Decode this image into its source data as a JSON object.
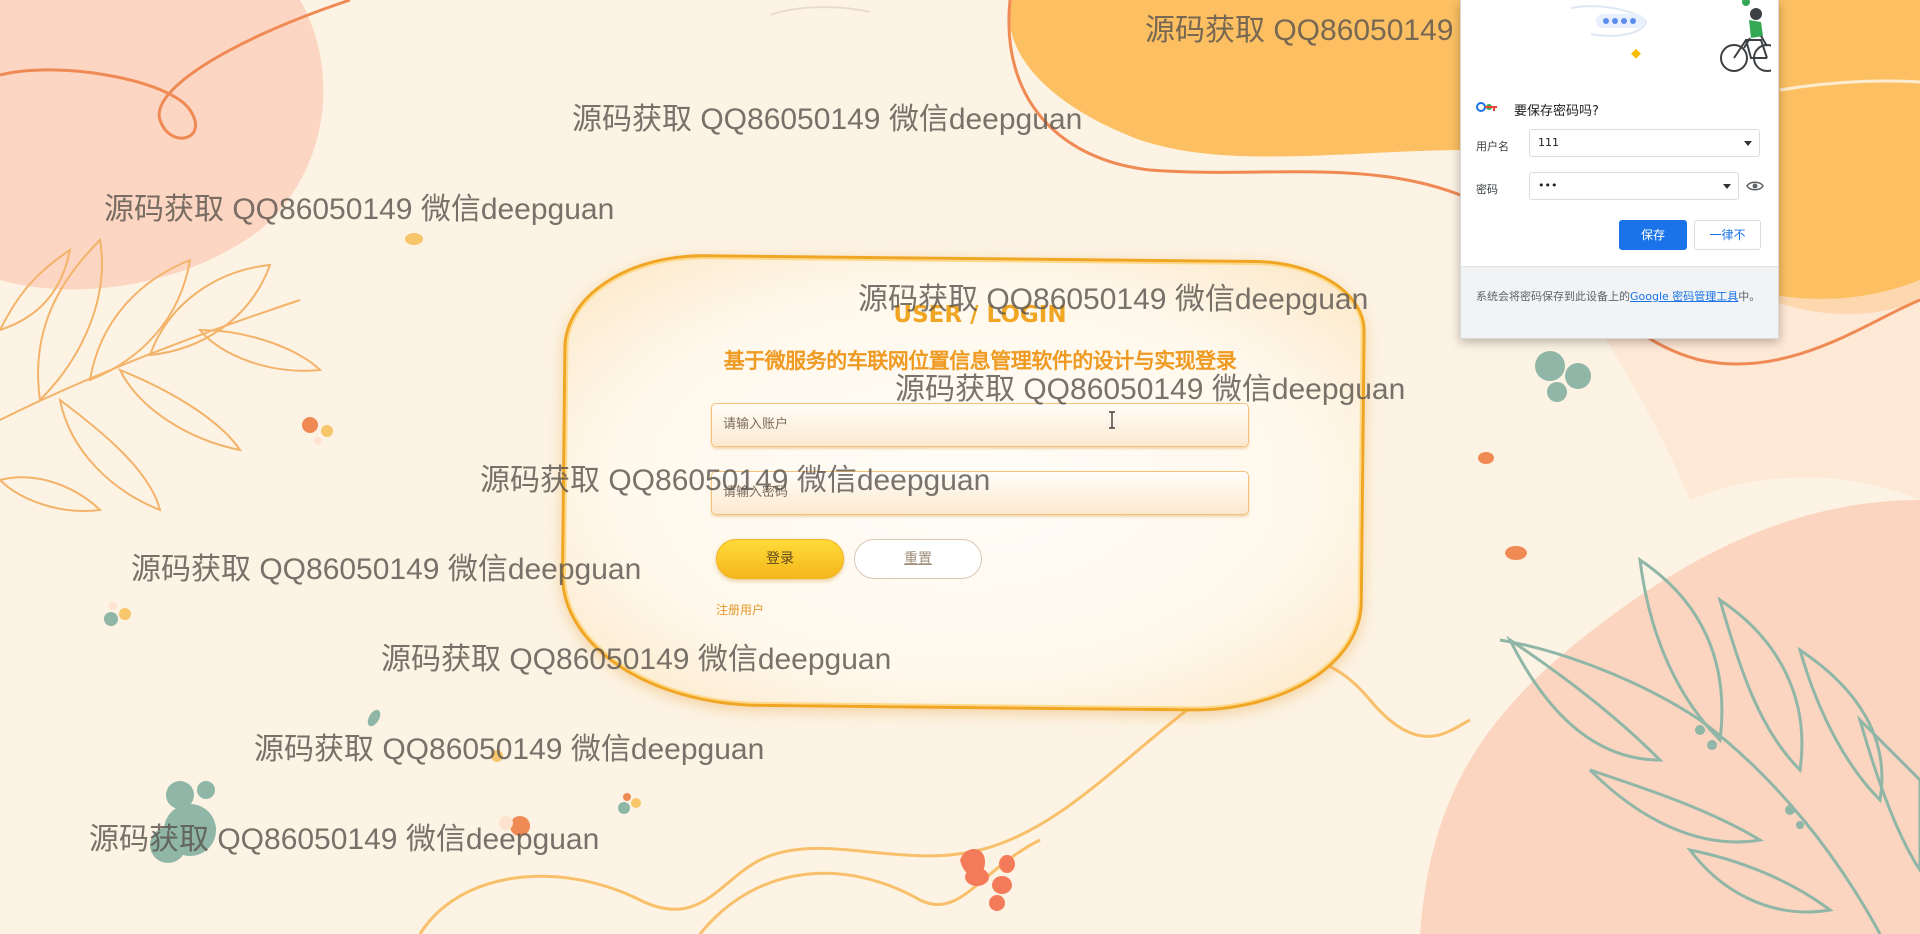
{
  "login": {
    "subtitle": "USER / LOGIN",
    "title": "基于微服务的车联网位置信息管理软件的设计与实现登录",
    "username_placeholder": "请输入账户",
    "password_placeholder": "请输入密码",
    "login_label": "登录",
    "reset_label": "重置",
    "register_label": "注册用户"
  },
  "watermark": "源码获取 QQ86050149 微信deepguan",
  "password_popup": {
    "question": "要保存密码吗?",
    "username_label": "用户名",
    "username_value": "111",
    "password_label": "密码",
    "password_value": "•••",
    "save_label": "保存",
    "never_label": "一律不",
    "footer_text": "系统会将密码保存到此设备上的",
    "footer_link": "Google 密码管理工具",
    "footer_suffix": "中。"
  },
  "colors": {
    "background": "#fdf3e4",
    "accent_orange": "#f0a623",
    "blob_orange": "#fcc063",
    "blob_peach": "#fcd5c0",
    "leaf_green": "#8fb6a6",
    "google_blue": "#1a73e8"
  }
}
